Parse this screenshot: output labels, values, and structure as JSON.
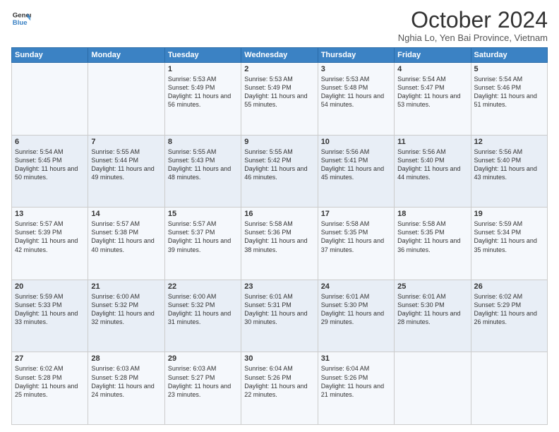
{
  "logo": {
    "line1": "General",
    "line2": "Blue",
    "icon_color": "#3b82c4"
  },
  "header": {
    "month_title": "October 2024",
    "subtitle": "Nghia Lo, Yen Bai Province, Vietnam"
  },
  "weekdays": [
    "Sunday",
    "Monday",
    "Tuesday",
    "Wednesday",
    "Thursday",
    "Friday",
    "Saturday"
  ],
  "weeks": [
    [
      {
        "day": "",
        "info": ""
      },
      {
        "day": "",
        "info": ""
      },
      {
        "day": "1",
        "info": "Sunrise: 5:53 AM\nSunset: 5:49 PM\nDaylight: 11 hours and 56 minutes."
      },
      {
        "day": "2",
        "info": "Sunrise: 5:53 AM\nSunset: 5:49 PM\nDaylight: 11 hours and 55 minutes."
      },
      {
        "day": "3",
        "info": "Sunrise: 5:53 AM\nSunset: 5:48 PM\nDaylight: 11 hours and 54 minutes."
      },
      {
        "day": "4",
        "info": "Sunrise: 5:54 AM\nSunset: 5:47 PM\nDaylight: 11 hours and 53 minutes."
      },
      {
        "day": "5",
        "info": "Sunrise: 5:54 AM\nSunset: 5:46 PM\nDaylight: 11 hours and 51 minutes."
      }
    ],
    [
      {
        "day": "6",
        "info": "Sunrise: 5:54 AM\nSunset: 5:45 PM\nDaylight: 11 hours and 50 minutes."
      },
      {
        "day": "7",
        "info": "Sunrise: 5:55 AM\nSunset: 5:44 PM\nDaylight: 11 hours and 49 minutes."
      },
      {
        "day": "8",
        "info": "Sunrise: 5:55 AM\nSunset: 5:43 PM\nDaylight: 11 hours and 48 minutes."
      },
      {
        "day": "9",
        "info": "Sunrise: 5:55 AM\nSunset: 5:42 PM\nDaylight: 11 hours and 46 minutes."
      },
      {
        "day": "10",
        "info": "Sunrise: 5:56 AM\nSunset: 5:41 PM\nDaylight: 11 hours and 45 minutes."
      },
      {
        "day": "11",
        "info": "Sunrise: 5:56 AM\nSunset: 5:40 PM\nDaylight: 11 hours and 44 minutes."
      },
      {
        "day": "12",
        "info": "Sunrise: 5:56 AM\nSunset: 5:40 PM\nDaylight: 11 hours and 43 minutes."
      }
    ],
    [
      {
        "day": "13",
        "info": "Sunrise: 5:57 AM\nSunset: 5:39 PM\nDaylight: 11 hours and 42 minutes."
      },
      {
        "day": "14",
        "info": "Sunrise: 5:57 AM\nSunset: 5:38 PM\nDaylight: 11 hours and 40 minutes."
      },
      {
        "day": "15",
        "info": "Sunrise: 5:57 AM\nSunset: 5:37 PM\nDaylight: 11 hours and 39 minutes."
      },
      {
        "day": "16",
        "info": "Sunrise: 5:58 AM\nSunset: 5:36 PM\nDaylight: 11 hours and 38 minutes."
      },
      {
        "day": "17",
        "info": "Sunrise: 5:58 AM\nSunset: 5:35 PM\nDaylight: 11 hours and 37 minutes."
      },
      {
        "day": "18",
        "info": "Sunrise: 5:58 AM\nSunset: 5:35 PM\nDaylight: 11 hours and 36 minutes."
      },
      {
        "day": "19",
        "info": "Sunrise: 5:59 AM\nSunset: 5:34 PM\nDaylight: 11 hours and 35 minutes."
      }
    ],
    [
      {
        "day": "20",
        "info": "Sunrise: 5:59 AM\nSunset: 5:33 PM\nDaylight: 11 hours and 33 minutes."
      },
      {
        "day": "21",
        "info": "Sunrise: 6:00 AM\nSunset: 5:32 PM\nDaylight: 11 hours and 32 minutes."
      },
      {
        "day": "22",
        "info": "Sunrise: 6:00 AM\nSunset: 5:32 PM\nDaylight: 11 hours and 31 minutes."
      },
      {
        "day": "23",
        "info": "Sunrise: 6:01 AM\nSunset: 5:31 PM\nDaylight: 11 hours and 30 minutes."
      },
      {
        "day": "24",
        "info": "Sunrise: 6:01 AM\nSunset: 5:30 PM\nDaylight: 11 hours and 29 minutes."
      },
      {
        "day": "25",
        "info": "Sunrise: 6:01 AM\nSunset: 5:30 PM\nDaylight: 11 hours and 28 minutes."
      },
      {
        "day": "26",
        "info": "Sunrise: 6:02 AM\nSunset: 5:29 PM\nDaylight: 11 hours and 26 minutes."
      }
    ],
    [
      {
        "day": "27",
        "info": "Sunrise: 6:02 AM\nSunset: 5:28 PM\nDaylight: 11 hours and 25 minutes."
      },
      {
        "day": "28",
        "info": "Sunrise: 6:03 AM\nSunset: 5:28 PM\nDaylight: 11 hours and 24 minutes."
      },
      {
        "day": "29",
        "info": "Sunrise: 6:03 AM\nSunset: 5:27 PM\nDaylight: 11 hours and 23 minutes."
      },
      {
        "day": "30",
        "info": "Sunrise: 6:04 AM\nSunset: 5:26 PM\nDaylight: 11 hours and 22 minutes."
      },
      {
        "day": "31",
        "info": "Sunrise: 6:04 AM\nSunset: 5:26 PM\nDaylight: 11 hours and 21 minutes."
      },
      {
        "day": "",
        "info": ""
      },
      {
        "day": "",
        "info": ""
      }
    ]
  ]
}
